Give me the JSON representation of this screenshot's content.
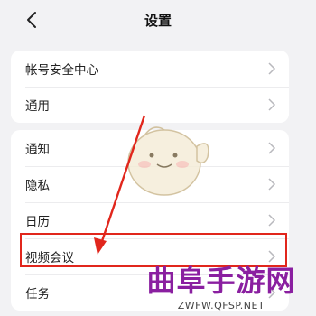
{
  "header": {
    "title": "设置"
  },
  "group1": [
    {
      "label": "帐号安全中心"
    },
    {
      "label": "通用"
    }
  ],
  "group2": [
    {
      "label": "通知"
    },
    {
      "label": "隐私"
    },
    {
      "label": "日历"
    },
    {
      "label": "视频会议"
    },
    {
      "label": "任务"
    }
  ],
  "watermark": {
    "brand": "曲阜手游网",
    "url": "ZWFW.QFSP.NET"
  },
  "colors": {
    "highlight": "#e1261c",
    "watermark": "#8a1fa0"
  },
  "icons": {
    "back": "chevron-left-icon",
    "row": "chevron-right-icon"
  }
}
